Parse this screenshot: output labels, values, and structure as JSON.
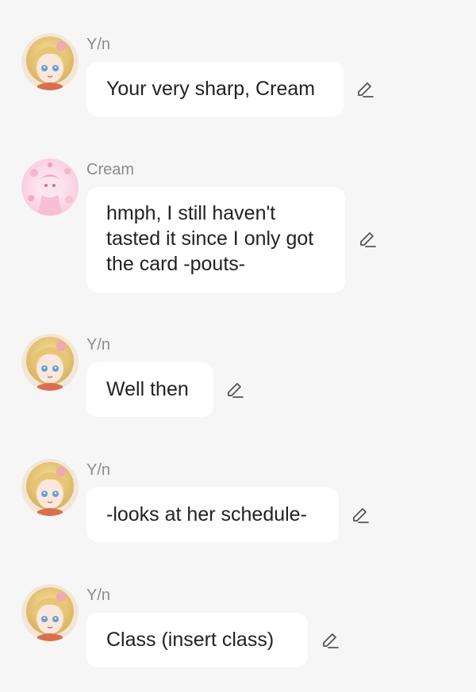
{
  "messages": [
    {
      "sender": "Y/n",
      "text": "Your very sharp, Cream"
    },
    {
      "sender": "Cream",
      "text": "hmph, I still haven't tasted it since I only got the card -pouts-"
    },
    {
      "sender": "Y/n",
      "text": "Well then"
    },
    {
      "sender": "Y/n",
      "text": "-looks at her schedule-"
    },
    {
      "sender": "Y/n",
      "text": "Class (insert class)"
    }
  ],
  "icons": {
    "edit": "pencil-edit-icon"
  },
  "colors": {
    "background": "#f6f6f6",
    "bubble": "#ffffff",
    "sender_text": "#8c8c8c",
    "message_text": "#222222",
    "icon": "#555555"
  }
}
